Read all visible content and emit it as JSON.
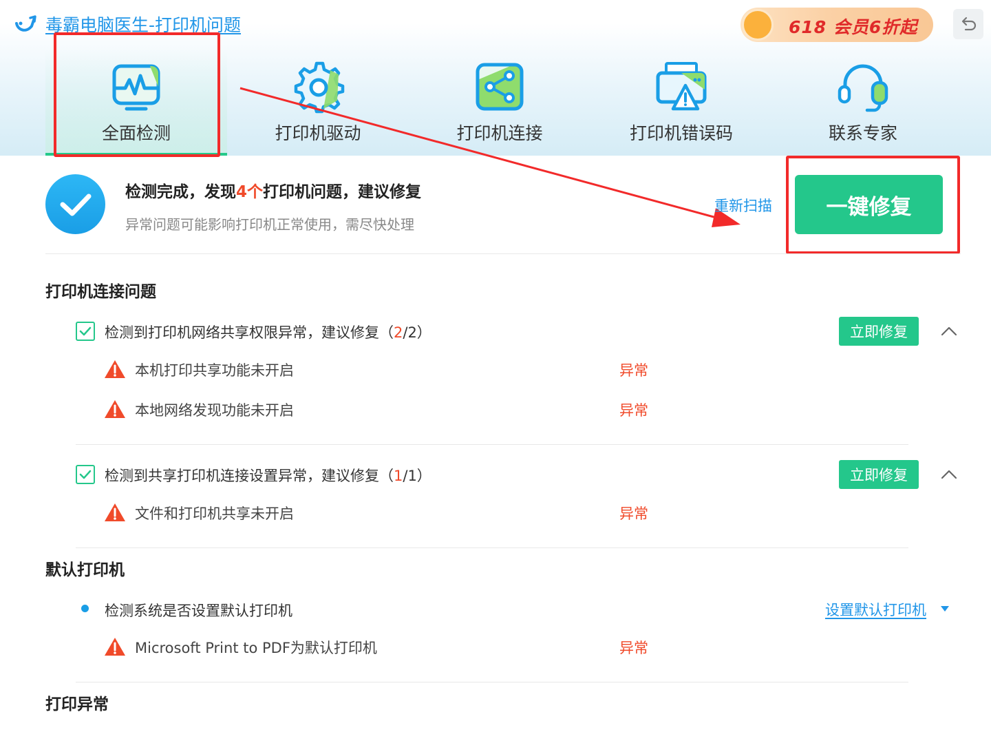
{
  "app": {
    "title": "毒霸电脑医生-打印机问题",
    "promo_text": "618 会员6折起"
  },
  "tabs": [
    {
      "label": "全面检测",
      "icon": "monitor-pulse-icon",
      "active": true
    },
    {
      "label": "打印机驱动",
      "icon": "gear-icon",
      "active": false
    },
    {
      "label": "打印机连接",
      "icon": "share-icon",
      "active": false
    },
    {
      "label": "打印机错误码",
      "icon": "printer-warning-icon",
      "active": false
    },
    {
      "label": "联系专家",
      "icon": "headset-icon",
      "active": false
    }
  ],
  "summary": {
    "title_prefix": "检测完成，发现",
    "count": "4个",
    "title_suffix": "打印机问题，建议修复",
    "subtitle": "异常问题可能影响打印机正常使用，需尽快处理",
    "rescan_label": "重新扫描",
    "fix_all_label": "一键修复"
  },
  "sections": {
    "connection": {
      "title": "打印机连接问题",
      "groups": [
        {
          "text": "检测到打印机网络共享权限异常，建议修复（",
          "fixed": "2",
          "total": "/2）",
          "fix_label": "立即修复",
          "items": [
            {
              "text": "本机打印共享功能未开启",
              "status": "异常"
            },
            {
              "text": "本地网络发现功能未开启",
              "status": "异常"
            }
          ]
        },
        {
          "text": "检测到共享打印机连接设置异常，建议修复（",
          "fixed": "1",
          "total": "/1）",
          "fix_label": "立即修复",
          "items": [
            {
              "text": "文件和打印机共享未开启",
              "status": "异常"
            }
          ]
        }
      ]
    },
    "default_printer": {
      "title": "默认打印机",
      "check_text": "检测系统是否设置默认打印机",
      "action_label": "设置默认打印机",
      "items": [
        {
          "text": "Microsoft Print to PDF为默认打印机",
          "status": "异常"
        }
      ]
    },
    "print_error": {
      "title": "打印异常"
    }
  },
  "colors": {
    "accent_green": "#24c78b",
    "link_blue": "#2196e8",
    "error_red": "#f04a2a",
    "annotation_red": "#f22a2a"
  }
}
